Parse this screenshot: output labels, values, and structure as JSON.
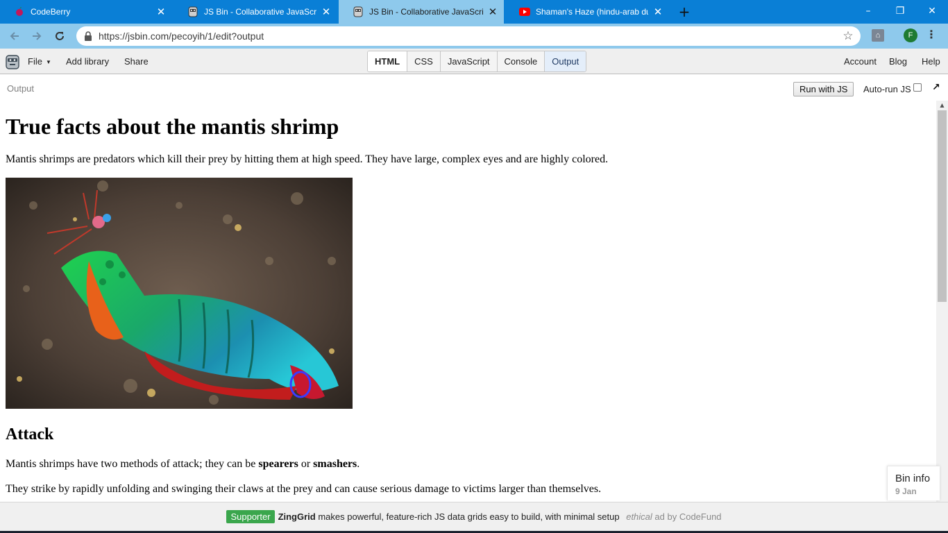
{
  "browser": {
    "tabs": [
      {
        "title": "CodeBerry",
        "icon": "codeberry-icon",
        "active": false
      },
      {
        "title": "JS Bin - Collaborative JavaScript Debugging",
        "icon": "jsbin-icon",
        "active": false
      },
      {
        "title": "JS Bin - Collaborative JavaScript Debugging",
        "icon": "jsbin-icon",
        "active": true
      },
      {
        "title": "Shaman's Haze (hindu-arab dub mix)",
        "icon": "youtube-icon",
        "active": false
      }
    ],
    "new_tab_icon": "+",
    "window_controls": {
      "minimize": "–",
      "restore": "❐",
      "close": "✕"
    },
    "address_bar": {
      "url": "https://jsbin.com/pecoyih/1/edit?output"
    },
    "profile_initial": "F",
    "accent_color": "#0a7fd6"
  },
  "jsbin": {
    "menu": {
      "file": "File",
      "add_library": "Add library",
      "share": "Share"
    },
    "panels": [
      "HTML",
      "CSS",
      "JavaScript",
      "Console",
      "Output"
    ],
    "right_links": {
      "account": "Account",
      "blog": "Blog",
      "help": "Help"
    },
    "output_label": "Output",
    "run_button": "Run with JS",
    "autorun_label": "Auto-run JS",
    "autorun_checked": false,
    "bin_info": {
      "title": "Bin info",
      "date": "9 Jan"
    }
  },
  "page": {
    "title": "True facts about the mantis shrimp",
    "intro": "Mantis shrimps are predators which kill their prey by hitting them at high speed. They have large, complex eyes and are highly colored.",
    "image_alt": "mantis shrimp",
    "attack_heading": "Attack",
    "attack_p1_before": "Mantis shrimps have two methods of attack; they can be ",
    "attack_p1_bold1": "spearers",
    "attack_p1_mid": " or ",
    "attack_p1_bold2": "smashers",
    "attack_p1_after": ".",
    "attack_p2": "They strike by rapidly unfolding and swinging their claws at the prey and can cause serious damage to victims larger than themselves."
  },
  "ad": {
    "badge": "Supporter",
    "brand": "ZingGrid",
    "text": " makes powerful, feature-rich JS data grids easy to build, with minimal setup ",
    "ethical": "ethical",
    "by": " ad by CodeFund"
  }
}
